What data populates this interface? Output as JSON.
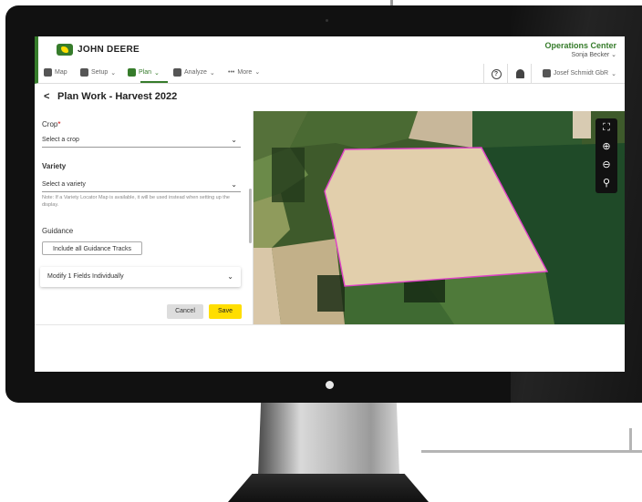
{
  "brand": {
    "name": "John Deere",
    "app_name": "Operations Center",
    "user_name": "Sonja Becker"
  },
  "nav": {
    "items": [
      {
        "label": "Map"
      },
      {
        "label": "Setup"
      },
      {
        "label": "Plan"
      },
      {
        "label": "Analyze"
      },
      {
        "label": "More"
      }
    ],
    "active": "Plan",
    "help_symbol": "?",
    "organization": "Josef Schmidt GbR"
  },
  "page": {
    "back_symbol": "<",
    "title": "Plan Work - Harvest 2022"
  },
  "form": {
    "crop_label": "Crop",
    "required_mark": "*",
    "crop_placeholder": "Select a crop",
    "variety_label": "Variety",
    "variety_placeholder": "Select a variety",
    "variety_note": "Note: If a Variety Locator Map is available, it will be used instead when setting up the display.",
    "guidance_label": "Guidance",
    "guidance_button": "Include all Guidance Tracks",
    "modify_label": "Modify 1 Fields Individually",
    "cancel_label": "Cancel",
    "save_label": "Save"
  },
  "colors": {
    "brand_green": "#367c2b",
    "brand_yellow": "#ffde00",
    "field_boundary": "#e040c8"
  },
  "icons": {
    "map_controls": [
      "fullscreen-icon",
      "zoom-in-icon",
      "zoom-out-icon",
      "locate-user-icon"
    ]
  }
}
